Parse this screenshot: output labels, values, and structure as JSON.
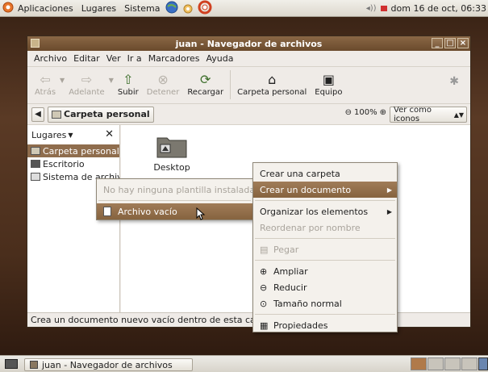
{
  "top_panel": {
    "menus": [
      "Aplicaciones",
      "Lugares",
      "Sistema"
    ],
    "clock": "dom 16 de oct, 06:33"
  },
  "window": {
    "title": "juan - Navegador de archivos",
    "menubar": [
      "Archivo",
      "Editar",
      "Ver",
      "Ir a",
      "Marcadores",
      "Ayuda"
    ],
    "toolbar": {
      "back": "Atrás",
      "forward": "Adelante",
      "up": "Subir",
      "stop": "Detener",
      "reload": "Recargar",
      "home": "Carpeta personal",
      "computer": "Equipo"
    },
    "location": {
      "crumb": "Carpeta personal",
      "zoom": "100%",
      "view_as": "Ver como iconos"
    },
    "sidebar": {
      "header": "Lugares",
      "items": [
        "Carpeta personal",
        "Escritorio",
        "Sistema de archivos"
      ]
    },
    "files": [
      {
        "name": "Desktop"
      }
    ],
    "status": "Crea un documento nuevo vacío dentro de esta carpeta"
  },
  "context_menu": {
    "items": [
      {
        "label": "Crear una carpeta",
        "state": "normal"
      },
      {
        "label": "Crear un documento",
        "state": "highlighted",
        "submenu": true
      },
      {
        "label": "Organizar los elementos",
        "state": "normal",
        "submenu": true
      },
      {
        "label": "Reordenar por nombre",
        "state": "disabled"
      },
      {
        "label": "Pegar",
        "state": "disabled",
        "icon": "paste-icon"
      },
      {
        "label": "Ampliar",
        "state": "normal",
        "icon": "zoom-in-icon"
      },
      {
        "label": "Reducir",
        "state": "normal",
        "icon": "zoom-out-icon"
      },
      {
        "label": "Tamaño normal",
        "state": "normal",
        "icon": "zoom-normal-icon"
      },
      {
        "label": "Propiedades",
        "state": "normal",
        "icon": "properties-icon"
      }
    ]
  },
  "submenu": {
    "no_templates": "No hay ninguna plantilla instalada",
    "empty_file": "Archivo vacío"
  },
  "taskbar": {
    "task_label": "juan - Navegador de archivos"
  },
  "colors": {
    "accent": "#8f6d4d",
    "titlebar": "#7a5a3b",
    "desktop": "#4a2e1c"
  }
}
